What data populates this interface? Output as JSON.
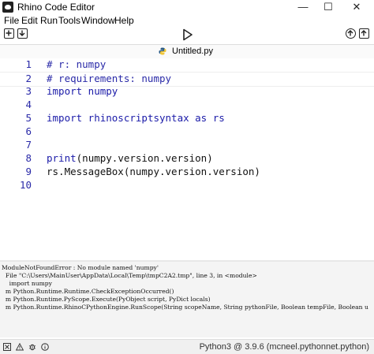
{
  "window": {
    "title": "Rhino Code Editor"
  },
  "menu": [
    "File",
    "Edit",
    "Run",
    "Tools",
    "Window",
    "Help"
  ],
  "tab": {
    "label": "Untitled.py"
  },
  "editor": {
    "lines": [
      {
        "num": "1",
        "text": "# r: numpy",
        "kind": "comment"
      },
      {
        "num": "2",
        "text": "# requirements: numpy",
        "kind": "comment"
      },
      {
        "num": "3",
        "text": "import numpy",
        "kind": "kw"
      },
      {
        "num": "4",
        "text": "",
        "kind": "plain"
      },
      {
        "num": "5",
        "text": "import rhinoscriptsyntax as rs",
        "kind": "kw"
      },
      {
        "num": "6",
        "text": "",
        "kind": "plain"
      },
      {
        "num": "7",
        "text": "",
        "kind": "plain"
      },
      {
        "num": "8",
        "text": "print(numpy.version.version)",
        "kind": "plain"
      },
      {
        "num": "9",
        "text": "rs.MessageBox(numpy.version.version)",
        "kind": "plain"
      },
      {
        "num": "10",
        "text": "",
        "kind": "plain"
      }
    ],
    "current_line": 2
  },
  "console": [
    "ModuleNotFoundError : No module named 'numpy'",
    "  File \"C:\\Users\\MainUser\\AppData\\Local\\Temp\\tmpC2A2.tmp\", line 3, in <module>",
    "    import numpy",
    "  m Python.Runtime.Runtime.CheckExceptionOccurred()",
    "  m Python.Runtime.PyScope.Execute(PyObject script, PyDict locals)",
    "  m Python.Runtime.RhinoCPythonEngine.RunScope(String scopeName, String pythonFile, Boolean tempFile, Boolean u"
  ],
  "status": {
    "runtime": "Python3 @ 3.9.6 (mcneel.pythonnet.python)"
  },
  "colors": {
    "comment": "#2a2aa8",
    "gutter": "#2a2aa8"
  }
}
